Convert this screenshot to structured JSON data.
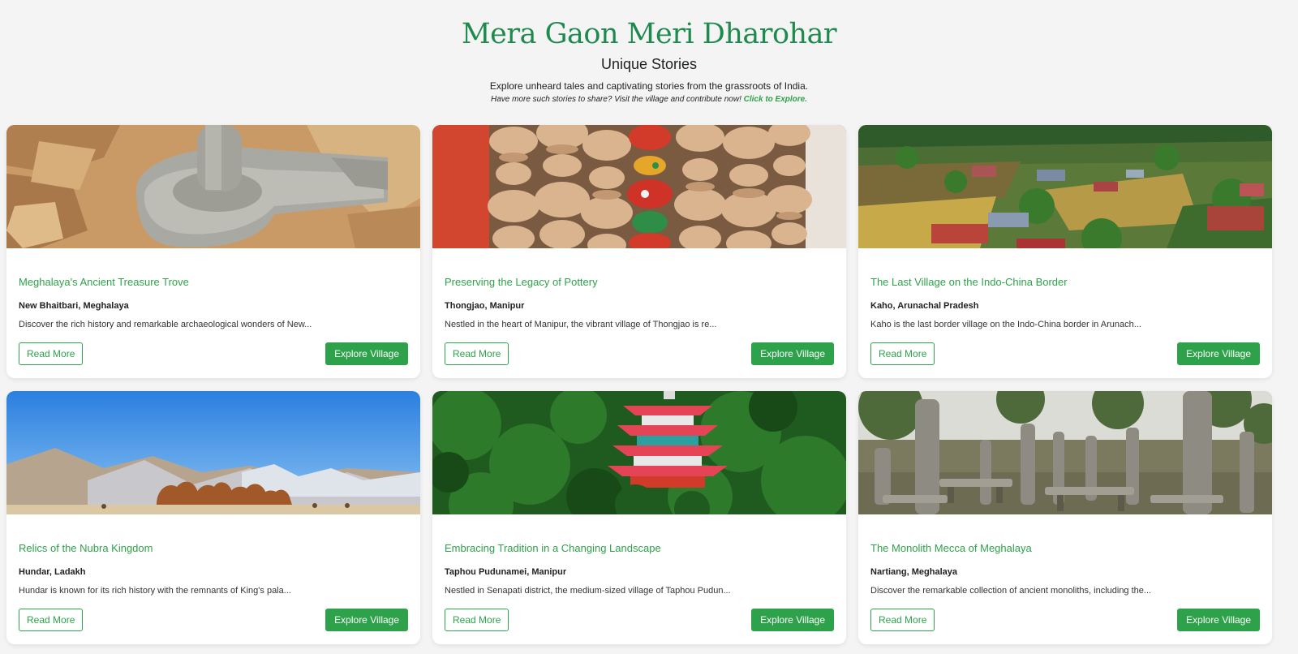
{
  "header": {
    "title": "Mera Gaon Meri Dharohar",
    "subtitle": "Unique Stories",
    "intro": "Explore unheard tales and captivating stories from the grassroots of India.",
    "note": "Have more such stories to share? Visit the village and contribute now!",
    "note_link": "Click to Explore."
  },
  "colors": {
    "accent": "#2ea24a",
    "title": "#1e8a4e",
    "background": "#f4f4f4"
  },
  "cards": [
    {
      "image": "stone-carving-image",
      "title": "Meghalaya's Ancient Treasure Trove",
      "location": "New Bhaitbari, Meghalaya",
      "description": "Discover the rich history and remarkable archaeological wonders of New...",
      "read_more": "Read More",
      "explore": "Explore Village"
    },
    {
      "image": "pottery-image",
      "title": "Preserving the Legacy of Pottery",
      "location": "Thongjao, Manipur",
      "description": "Nestled in the heart of Manipur, the vibrant village of Thongjao is re...",
      "read_more": "Read More",
      "explore": "Explore Village"
    },
    {
      "image": "village-aerial-image",
      "title": "The Last Village on the Indo-China Border",
      "location": "Kaho, Arunachal Pradesh",
      "description": "Kaho is the last border village on the Indo-China border in Arunach...",
      "read_more": "Read More",
      "explore": "Explore Village"
    },
    {
      "image": "camels-mountains-image",
      "title": "Relics of the Nubra Kingdom",
      "location": "Hundar, Ladakh",
      "description": "Hundar is known for its rich history with the remnants of King's pala...",
      "read_more": "Read More",
      "explore": "Explore Village"
    },
    {
      "image": "pagoda-forest-image",
      "title": "Embracing Tradition in a Changing Landscape",
      "location": "Taphou Pudunamei, Manipur",
      "description": "Nestled in Senapati district, the medium-sized village of Taphou Pudun...",
      "read_more": "Read More",
      "explore": "Explore Village"
    },
    {
      "image": "monoliths-image",
      "title": "The Monolith Mecca of Meghalaya",
      "location": "Nartiang, Meghalaya",
      "description": "Discover the remarkable collection of ancient monoliths, including the...",
      "read_more": "Read More",
      "explore": "Explore Village"
    }
  ]
}
